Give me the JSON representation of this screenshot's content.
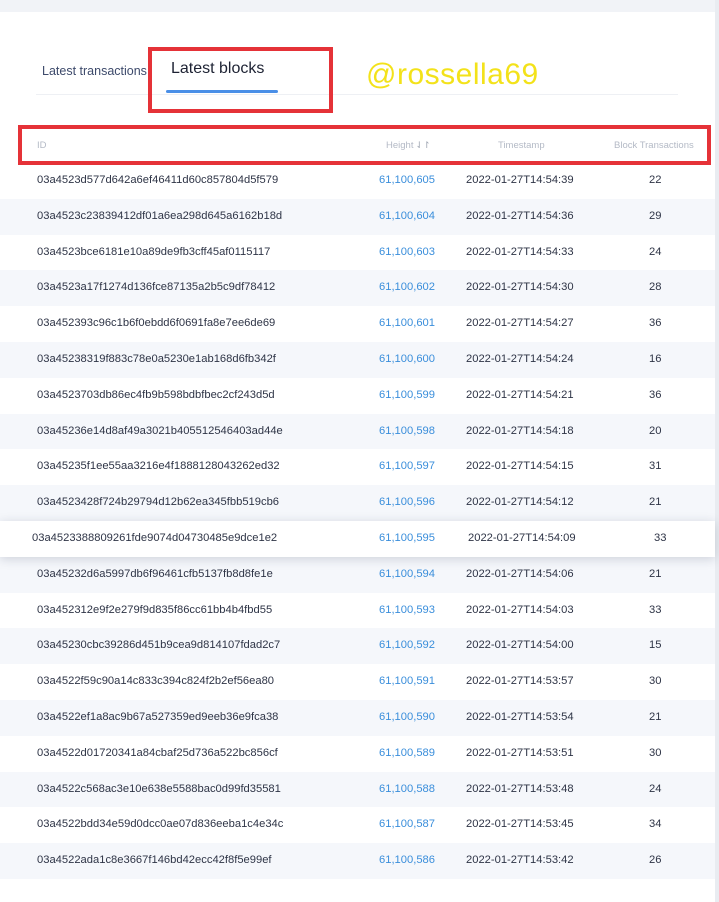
{
  "tabs": {
    "transactions_label": "Latest transactions",
    "blocks_label": "Latest blocks",
    "active": "Latest blocks"
  },
  "watermark": "@rossella69",
  "table": {
    "columns": {
      "id": "ID",
      "height": "Height",
      "timestamp": "Timestamp",
      "block_transactions": "Block Transactions"
    },
    "rows": [
      {
        "id": "03a4523d577d642a6ef46411d60c857804d5f579",
        "height": "61,100,605",
        "timestamp": "2022-01-27T14:54:39",
        "block_transactions": "22"
      },
      {
        "id": "03a4523c23839412df01a6ea298d645a6162b18d",
        "height": "61,100,604",
        "timestamp": "2022-01-27T14:54:36",
        "block_transactions": "29"
      },
      {
        "id": "03a4523bce6181e10a89de9fb3cff45af0115117",
        "height": "61,100,603",
        "timestamp": "2022-01-27T14:54:33",
        "block_transactions": "24"
      },
      {
        "id": "03a4523a17f1274d136fce87135a2b5c9df78412",
        "height": "61,100,602",
        "timestamp": "2022-01-27T14:54:30",
        "block_transactions": "28"
      },
      {
        "id": "03a452393c96c1b6f0ebdd6f0691fa8e7ee6de69",
        "height": "61,100,601",
        "timestamp": "2022-01-27T14:54:27",
        "block_transactions": "36"
      },
      {
        "id": "03a45238319f883c78e0a5230e1ab168d6fb342f",
        "height": "61,100,600",
        "timestamp": "2022-01-27T14:54:24",
        "block_transactions": "16"
      },
      {
        "id": "03a4523703db86ec4fb9b598bdbfbec2cf243d5d",
        "height": "61,100,599",
        "timestamp": "2022-01-27T14:54:21",
        "block_transactions": "36"
      },
      {
        "id": "03a45236e14d8af49a3021b405512546403ad44e",
        "height": "61,100,598",
        "timestamp": "2022-01-27T14:54:18",
        "block_transactions": "20"
      },
      {
        "id": "03a45235f1ee55aa3216e4f1888128043262ed32",
        "height": "61,100,597",
        "timestamp": "2022-01-27T14:54:15",
        "block_transactions": "31"
      },
      {
        "id": "03a4523428f724b29794d12b62ea345fbb519cb6",
        "height": "61,100,596",
        "timestamp": "2022-01-27T14:54:12",
        "block_transactions": "21"
      },
      {
        "id": "03a4523388809261fde9074d04730485e9dce1e2",
        "height": "61,100,595",
        "timestamp": "2022-01-27T14:54:09",
        "block_transactions": "33"
      },
      {
        "id": "03a45232d6a5997db6f96461cfb5137fb8d8fe1e",
        "height": "61,100,594",
        "timestamp": "2022-01-27T14:54:06",
        "block_transactions": "21"
      },
      {
        "id": "03a452312e9f2e279f9d835f86cc61bb4b4fbd55",
        "height": "61,100,593",
        "timestamp": "2022-01-27T14:54:03",
        "block_transactions": "33"
      },
      {
        "id": "03a45230cbc39286d451b9cea9d814107fdad2c7",
        "height": "61,100,592",
        "timestamp": "2022-01-27T14:54:00",
        "block_transactions": "15"
      },
      {
        "id": "03a4522f59c90a14c833c394c824f2b2ef56ea80",
        "height": "61,100,591",
        "timestamp": "2022-01-27T14:53:57",
        "block_transactions": "30"
      },
      {
        "id": "03a4522ef1a8ac9b67a527359ed9eeb36e9fca38",
        "height": "61,100,590",
        "timestamp": "2022-01-27T14:53:54",
        "block_transactions": "21"
      },
      {
        "id": "03a4522d01720341a84cbaf25d736a522bc856cf",
        "height": "61,100,589",
        "timestamp": "2022-01-27T14:53:51",
        "block_transactions": "30"
      },
      {
        "id": "03a4522c568ac3e10e638e5588bac0d99fd35581",
        "height": "61,100,588",
        "timestamp": "2022-01-27T14:53:48",
        "block_transactions": "24"
      },
      {
        "id": "03a4522bdd34e59d0dcc0ae07d836eeba1c4e34c",
        "height": "61,100,587",
        "timestamp": "2022-01-27T14:53:45",
        "block_transactions": "34"
      },
      {
        "id": "03a4522ada1c8e3667f146bd42ecc42f8f5e99ef",
        "height": "61,100,586",
        "timestamp": "2022-01-27T14:53:42",
        "block_transactions": "26"
      }
    ]
  },
  "colors": {
    "accent_blue": "#3a8edb",
    "tab_underline": "#4a8fe7",
    "annotation_red": "#e53238",
    "watermark_yellow": "#f3e21a"
  },
  "icons": {
    "sort": "sort-icon"
  }
}
